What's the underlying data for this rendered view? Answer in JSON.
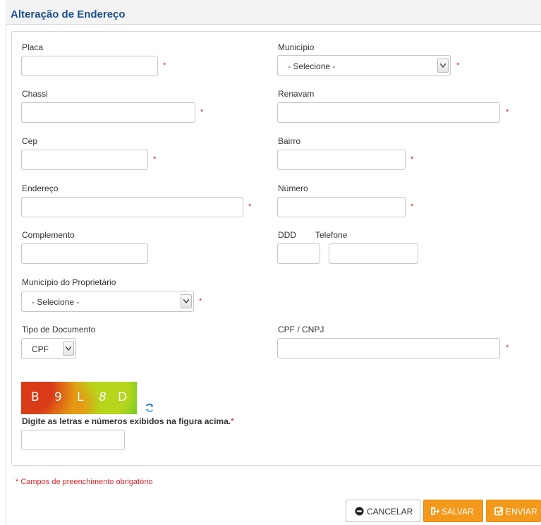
{
  "header": {
    "title": "Alteração de Endereço"
  },
  "form": {
    "placa": {
      "label": "Placa",
      "value": ""
    },
    "municipio": {
      "label": "Município",
      "selected": "- Selecione -"
    },
    "chassi": {
      "label": "Chassi",
      "value": ""
    },
    "renavam": {
      "label": "Renavam",
      "value": ""
    },
    "cep": {
      "label": "Cep",
      "value": ""
    },
    "bairro": {
      "label": "Bairro",
      "value": ""
    },
    "endereco": {
      "label": "Endereço",
      "value": ""
    },
    "numero": {
      "label": "Número",
      "value": ""
    },
    "complemento": {
      "label": "Complemento",
      "value": ""
    },
    "ddd": {
      "label": "DDD",
      "value": ""
    },
    "telefone": {
      "label": "Telefone",
      "value": ""
    },
    "municipio_proprietario": {
      "label": "Município do Proprietário",
      "selected": "- Selecione -"
    },
    "tipo_documento": {
      "label": "Tipo de Documento",
      "selected": "CPF"
    },
    "cpf_cnpj": {
      "label": "CPF / CNPJ",
      "value": ""
    },
    "required_mark": "*"
  },
  "captcha": {
    "chars": [
      "B",
      "9",
      "L",
      "8",
      "D"
    ],
    "label": "Digite as letras e números exibidos na figura acima.",
    "value": ""
  },
  "footer": {
    "mandatory_note": "* Campos de preenchimento obrigatório",
    "cancel_label": "CANCELAR",
    "save_label": "SALVAR",
    "send_label": "ENVIAR"
  },
  "colors": {
    "title": "#1d4f8c",
    "required": "#d9242a",
    "accent_button": "#f39a1d"
  },
  "icons": {
    "select_arrow": "chevron-down-icon",
    "refresh": "refresh-icon",
    "cancel": "cancel-circle-icon",
    "save": "save-icon",
    "send": "check-square-icon"
  }
}
